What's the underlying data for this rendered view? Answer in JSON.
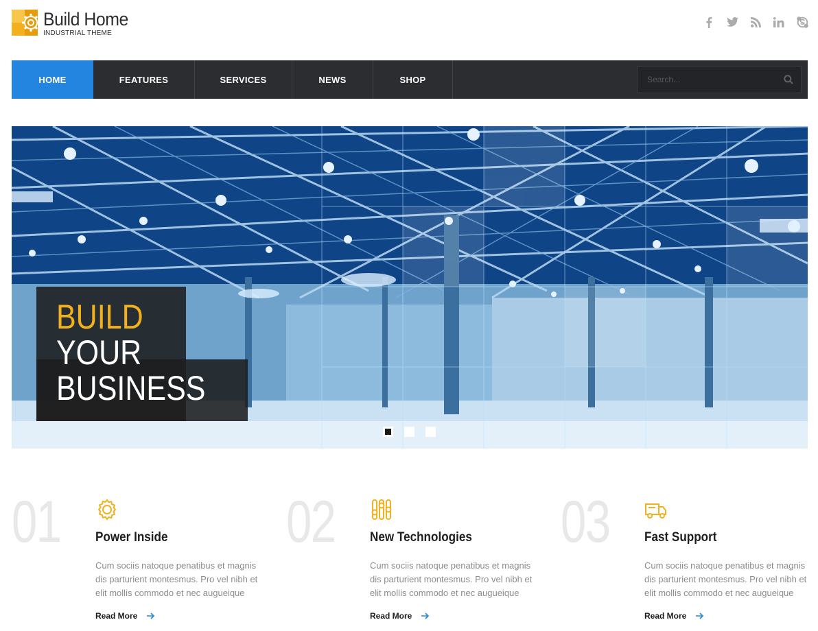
{
  "brand": {
    "title": "Build Home",
    "subtitle": "INDUSTRIAL THEME",
    "accent": "#f2b01e"
  },
  "social": [
    "facebook-icon",
    "twitter-icon",
    "rss-icon",
    "linkedin-icon",
    "skype-icon"
  ],
  "nav": {
    "items": [
      {
        "label": "HOME",
        "active": true
      },
      {
        "label": "FEATURES",
        "active": false
      },
      {
        "label": "SERVICES",
        "active": false
      },
      {
        "label": "NEWS",
        "active": false
      },
      {
        "label": "SHOP",
        "active": false
      }
    ],
    "search_placeholder": "Search...",
    "active_color": "#2485e0",
    "bar_color": "#2b2d31"
  },
  "hero": {
    "line1": "BUILD",
    "line2": "YOUR",
    "line3": "BUSINESS",
    "slides": 3,
    "active_slide": 1
  },
  "features": [
    {
      "number": "01",
      "icon": "gear-icon",
      "title": "Power Inside",
      "description": "Cum sociis natoque penatibus et magnis dis parturient montesmus. Pro vel nibh et elit mollis commodo et nec augueique",
      "link": "Read More"
    },
    {
      "number": "02",
      "icon": "sliders-icon",
      "title": "New Technologies",
      "description": "Cum sociis natoque penatibus et magnis dis parturient montesmus. Pro vel nibh et elit mollis commodo et nec augueique",
      "link": "Read More"
    },
    {
      "number": "03",
      "icon": "truck-icon",
      "title": "Fast Support",
      "description": "Cum sociis natoque penatibus et magnis dis parturient montesmus. Pro vel nibh et elit mollis commodo et nec augueique",
      "link": "Read More"
    }
  ]
}
